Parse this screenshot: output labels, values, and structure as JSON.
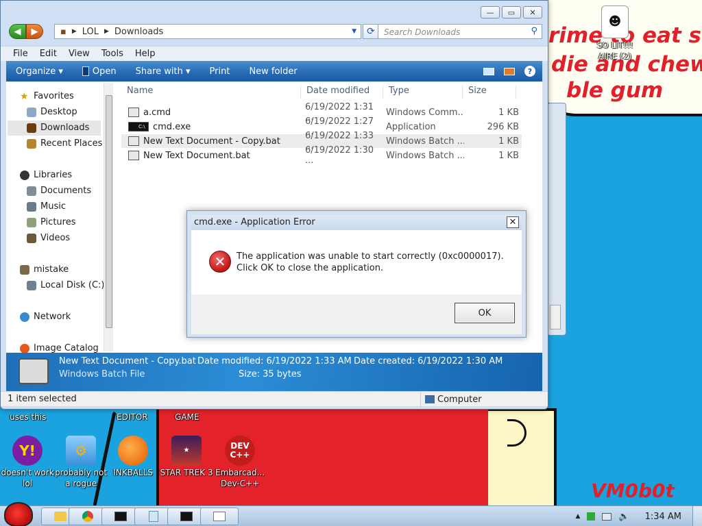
{
  "desktop": {
    "scrawl_lines": [
      "rime to eat shit",
      "die and chew",
      "ble gum"
    ],
    "signature": "VM0b0t",
    "top_labels": {
      "uses_this": "uses this",
      "editor": "EDITOR",
      "game": "GAME"
    },
    "icons": [
      {
        "id": "so-lit",
        "label": "SO LIT!!! AIRE (2)"
      },
      {
        "id": "yahoo",
        "label": "doesn't work lol"
      },
      {
        "id": "probably",
        "label": "probably not a rogue"
      },
      {
        "id": "inkballs",
        "label": "INKBALLS"
      },
      {
        "id": "startrek",
        "label": "STAR TREK 3"
      },
      {
        "id": "devcpp",
        "label": "Embarcad... Dev-C++"
      }
    ]
  },
  "explorer": {
    "title_buttons": {
      "minimize": "—",
      "maximize": "▭",
      "close": "✕"
    },
    "breadcrumb": [
      "LOL",
      "Downloads"
    ],
    "search_placeholder": "Search Downloads",
    "menu": [
      "File",
      "Edit",
      "View",
      "Tools",
      "Help"
    ],
    "commands": [
      "Organize ▾",
      "Open",
      "Share with ▾",
      "Print",
      "New folder"
    ],
    "nav": {
      "favorites_header": "Favorites",
      "favorites": [
        "Desktop",
        "Downloads",
        "Recent Places"
      ],
      "libraries_header": "Libraries",
      "libraries": [
        "Documents",
        "Music",
        "Pictures",
        "Videos"
      ],
      "computer_header": "mistake",
      "computer": [
        "Local Disk (C:)"
      ],
      "network": "Network",
      "image_catalog": "Image Catalog"
    },
    "columns": [
      "Name",
      "Date modified",
      "Type",
      "Size"
    ],
    "files": [
      {
        "name": "a.cmd",
        "date": "6/19/2022 1:31 ...",
        "type": "Windows Comm...",
        "size": "1 KB"
      },
      {
        "name": "cmd.exe",
        "date": "6/19/2022 1:27 ...",
        "type": "Application",
        "size": "296 KB"
      },
      {
        "name": "New Text Document - Copy.bat",
        "date": "6/19/2022 1:33 ...",
        "type": "Windows Batch ...",
        "size": "1 KB"
      },
      {
        "name": "New Text Document.bat",
        "date": "6/19/2022 1:30 ...",
        "type": "Windows Batch ...",
        "size": "1 KB"
      }
    ],
    "details": {
      "file_name": "New Text Document - Copy.bat",
      "file_type": "Windows Batch File",
      "modified_label": "Date modified:",
      "modified_value": "6/19/2022 1:33 AM",
      "created_label": "Date created:",
      "created_value": "6/19/2022 1:30 AM",
      "size_label": "Size:",
      "size_value": "35 bytes"
    },
    "status": {
      "left": "1 item selected",
      "right": "Computer"
    }
  },
  "dialog": {
    "title": "cmd.exe - Application Error",
    "close": "✕",
    "message": "The application was unable to start correctly (0xc0000017). Click OK to close the application.",
    "ok_label": "OK"
  },
  "taskbar": {
    "clock": "1:34 AM"
  },
  "colors": {
    "wallpaper_blue": "#1aa3df",
    "scrawl_red": "#e0202a",
    "command_bar": "#2b6eb7"
  }
}
